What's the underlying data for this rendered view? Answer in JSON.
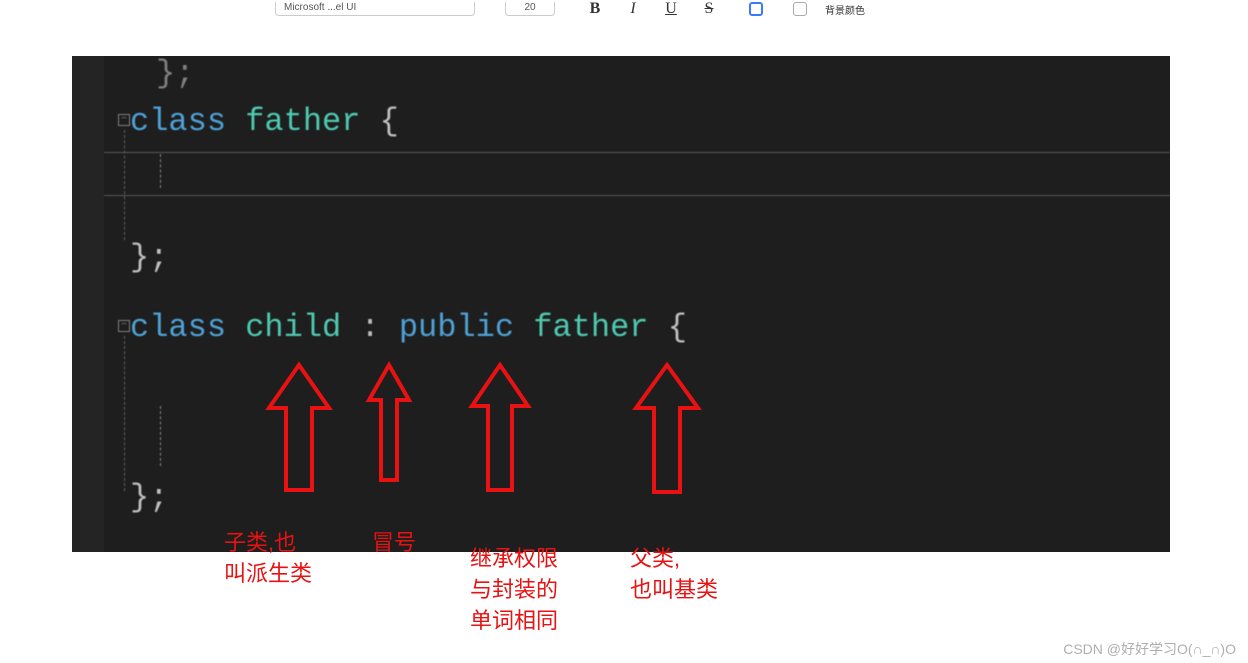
{
  "toolbar": {
    "font_select_preview": "Microsoft ...el UI",
    "size_preview": "20",
    "bold": "B",
    "italic": "I",
    "underline": "U",
    "strike": "S",
    "bgcolor_label": "背景颜色"
  },
  "code": {
    "line0": "};",
    "line1_class": "class ",
    "line1_father": "father ",
    "line1_brace": "{",
    "line4_close": "};",
    "line6_class": "class ",
    "line6_child": "child ",
    "line6_colon_sp": ": ",
    "line6_public": "public ",
    "line6_father": "father ",
    "line6_brace": "{",
    "line8_close": "};"
  },
  "annotations": {
    "label_child": "子类,也\n叫派生类",
    "label_colon": "冒号",
    "label_public": "继承权限\n与封装的\n单词相同",
    "label_father": "父类,\n也叫基类"
  },
  "watermark": "CSDN @好好学习O(∩_∩)O"
}
